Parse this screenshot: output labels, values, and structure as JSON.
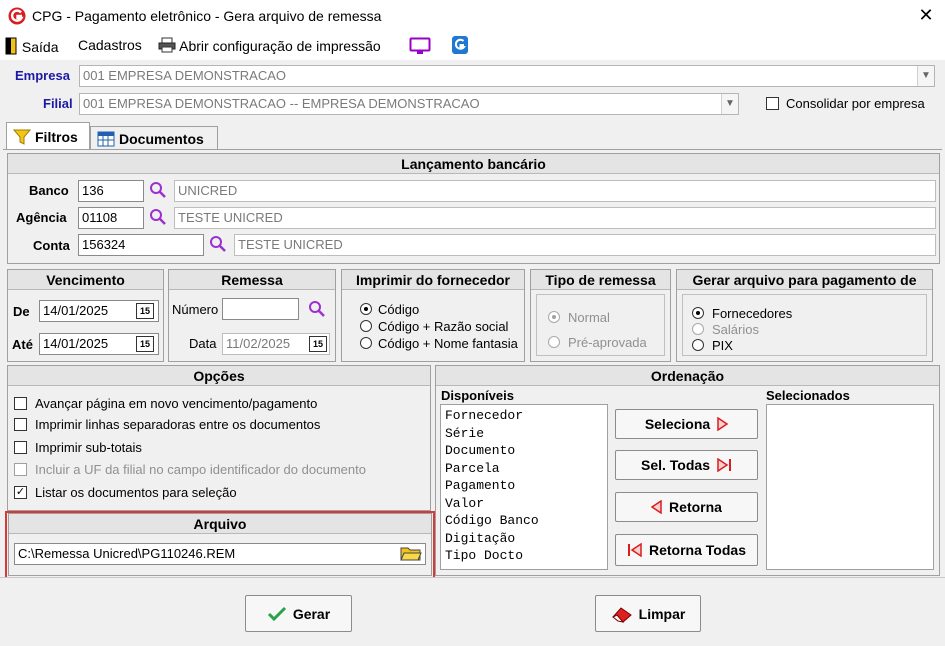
{
  "window": {
    "title": "CPG - Pagamento eletrônico - Gera arquivo de remessa",
    "close": "✕"
  },
  "menu": {
    "saida": "Saída",
    "cadastros": "Cadastros",
    "abrir_config": "Abrir configuração de impressão"
  },
  "empresa": {
    "label": "Empresa",
    "value": "001 EMPRESA DEMONSTRACAO"
  },
  "filial": {
    "label": "Filial",
    "value": "001 EMPRESA DEMONSTRACAO -- EMPRESA DEMONSTRACAO",
    "consolidar_label": "Consolidar por empresa",
    "consolidar_checked": false
  },
  "tabs": [
    {
      "label": "Filtros",
      "icon": "filter-icon"
    },
    {
      "label": "Documentos",
      "icon": "table-icon"
    }
  ],
  "lancamento": {
    "title": "Lançamento bancário",
    "banco_label": "Banco",
    "banco_code": "136",
    "banco_name": "UNICRED",
    "agencia_label": "Agência",
    "agencia_code": "01108",
    "agencia_name": "TESTE UNICRED",
    "conta_label": "Conta",
    "conta_code": "156324",
    "conta_name": "TESTE UNICRED"
  },
  "vencimento": {
    "title": "Vencimento",
    "de_label": "De",
    "de_value": "14/01/2025",
    "ate_label": "Até",
    "ate_value": "14/01/2025",
    "cal": "15"
  },
  "remessa": {
    "title": "Remessa",
    "numero_label": "Número",
    "numero_value": "",
    "data_label": "Data",
    "data_value": "11/02/2025",
    "cal": "15"
  },
  "imprimir_fornecedor": {
    "title": "Imprimir do fornecedor",
    "options": [
      "Código",
      "Código + Razão social",
      "Código + Nome fantasia"
    ],
    "selected": 0
  },
  "tipo_remessa": {
    "title": "Tipo de remessa",
    "options": [
      "Normal",
      "Pré-aprovada"
    ],
    "selected": 0
  },
  "gerar_para": {
    "title": "Gerar arquivo para pagamento de",
    "options": [
      "Fornecedores",
      "Salários",
      "PIX"
    ],
    "selected": 0
  },
  "opcoes": {
    "title": "Opções",
    "items": [
      {
        "label": "Avançar página em novo vencimento/pagamento",
        "checked": false,
        "enabled": true
      },
      {
        "label": "Imprimir linhas separadoras entre os documentos",
        "checked": false,
        "enabled": true
      },
      {
        "label": "Imprimir sub-totais",
        "checked": false,
        "enabled": true
      },
      {
        "label": "Incluir a UF da filial no campo identificador do documento",
        "checked": false,
        "enabled": false
      },
      {
        "label": "Listar os documentos para seleção",
        "checked": true,
        "enabled": true
      }
    ]
  },
  "arquivo": {
    "title": "Arquivo",
    "value": "C:\\Remessa Unicred\\PG110246.REM"
  },
  "ordenacao": {
    "title": "Ordenação",
    "disponiveis_label": "Disponíveis",
    "selecionados_label": "Selecionados",
    "disponiveis": [
      "Fornecedor",
      "Série",
      "Documento",
      "Parcela",
      "Pagamento",
      "Valor",
      "Código Banco",
      "Digitação",
      "Tipo Docto"
    ],
    "selecionados": [],
    "btn_seleciona": "Seleciona",
    "btn_sel_todas": "Sel. Todas",
    "btn_retorna": "Retorna",
    "btn_retorna_todas": "Retorna Todas"
  },
  "actions": {
    "gerar": "Gerar",
    "limpar": "Limpar"
  },
  "colors": {
    "accent_red": "#cc0000",
    "label_blue": "#1a1aa6",
    "highlight_border": "#d43a3a",
    "check_green": "#2aa24a"
  }
}
